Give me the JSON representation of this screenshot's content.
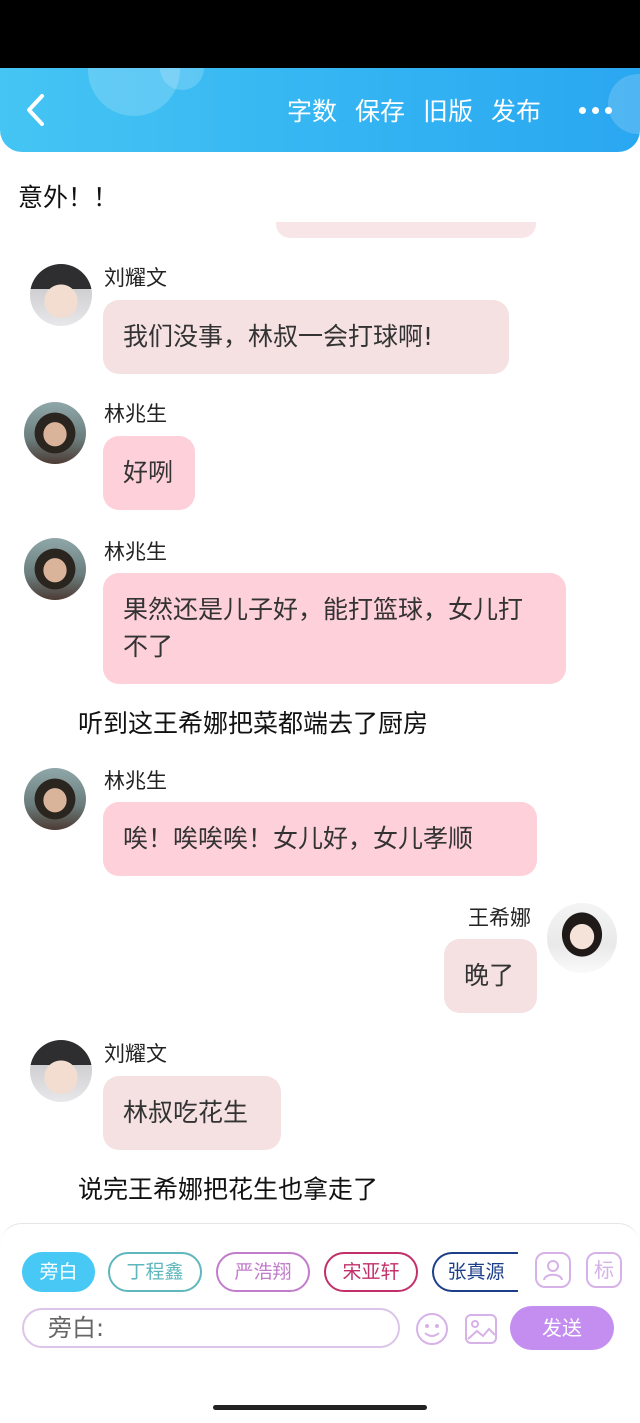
{
  "header": {
    "actions": [
      "字数",
      "保存",
      "旧版",
      "发布"
    ]
  },
  "chat": {
    "top_narration": "意外！！",
    "messages": [
      {
        "sender": "刘耀文",
        "text": "我们没事，林叔一会打球啊!",
        "style": "beige"
      },
      {
        "sender": "林兆生",
        "text": "好咧",
        "style": "pink"
      },
      {
        "sender": "林兆生",
        "text": "果然还是儿子好，能打篮球，女儿打不了",
        "style": "pink"
      },
      {
        "sender": "林兆生",
        "text": "唉！唉唉唉！女儿好，女儿孝顺",
        "style": "pink"
      },
      {
        "sender": "王希娜",
        "text": "晚了",
        "style": "beige"
      },
      {
        "sender": "刘耀文",
        "text": "林叔吃花生",
        "style": "beige"
      }
    ],
    "narrations": [
      "听到这王希娜把菜都端去了厨房",
      "说完王希娜把花生也拿走了"
    ]
  },
  "characters": [
    {
      "label": "旁白",
      "color": "#48c9f5",
      "active": true
    },
    {
      "label": "丁程鑫",
      "color": "#5fb7bd"
    },
    {
      "label": "严浩翔",
      "color": "#c27ccc"
    },
    {
      "label": "宋亚轩",
      "color": "#c2306a"
    },
    {
      "label": "张真源",
      "color": "#1d3f8a"
    }
  ],
  "toolbar": {
    "tag_label": "标",
    "input_value": "旁白:",
    "send_label": "发送"
  },
  "colors": {
    "header_blue": "#34b4f2",
    "pink_bubble": "#fdd0da",
    "beige_bubble": "#f5e1e2",
    "send_purple": "#c38ef0"
  }
}
